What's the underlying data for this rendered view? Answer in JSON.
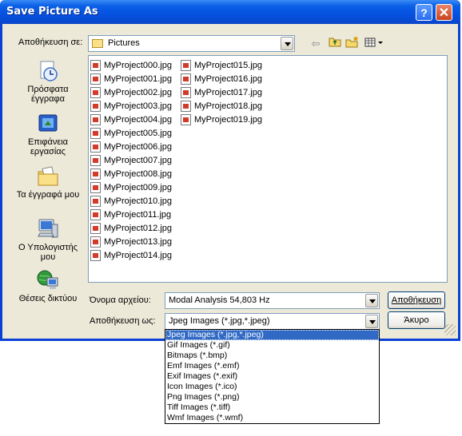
{
  "window": {
    "title": "Save Picture As",
    "help_glyph": "?",
    "close_glyph": "✕"
  },
  "savein": {
    "label": "Αποθήκευση σε:",
    "value": "Pictures"
  },
  "places": [
    {
      "name": "recent",
      "label": "Πρόσφατα έγγραφα",
      "icon": "recent-documents-icon"
    },
    {
      "name": "desktop",
      "label": "Επιφάνεια εργασίας",
      "icon": "desktop-icon"
    },
    {
      "name": "mydocs",
      "label": "Τα έγγραφά μου",
      "icon": "my-documents-icon"
    },
    {
      "name": "mycomputer",
      "label": "Ο Υπολογιστής μου",
      "icon": "my-computer-icon"
    },
    {
      "name": "network",
      "label": "Θέσεις δικτύου",
      "icon": "network-places-icon"
    }
  ],
  "files": {
    "col1": [
      "MyProject000.jpg",
      "MyProject001.jpg",
      "MyProject002.jpg",
      "MyProject003.jpg",
      "MyProject004.jpg",
      "MyProject005.jpg",
      "MyProject006.jpg",
      "MyProject007.jpg",
      "MyProject008.jpg",
      "MyProject009.jpg",
      "MyProject010.jpg",
      "MyProject011.jpg",
      "MyProject012.jpg",
      "MyProject013.jpg",
      "MyProject014.jpg"
    ],
    "col2": [
      "MyProject015.jpg",
      "MyProject016.jpg",
      "MyProject017.jpg",
      "MyProject018.jpg",
      "MyProject019.jpg"
    ]
  },
  "filename": {
    "label": "Όνομα αρχείου:",
    "value": "Modal Analysis 54,803 Hz"
  },
  "savetype": {
    "label": "Αποθήκευση ως:",
    "value": "Jpeg Images (*.jpg,*.jpeg)",
    "options": [
      "Jpeg Images (*.jpg,*.jpeg)",
      "Gif Images (*.gif)",
      "Bitmaps (*.bmp)",
      "Emf Images (*.emf)",
      "Exif Images (*.exif)",
      "Icon Images (*.ico)",
      "Png Images (*.png)",
      "Tiff Images (*.tiff)",
      "Wmf Images (*.wmf)"
    ]
  },
  "buttons": {
    "save": "Αποθήκευση",
    "cancel": "Άκυρο"
  }
}
